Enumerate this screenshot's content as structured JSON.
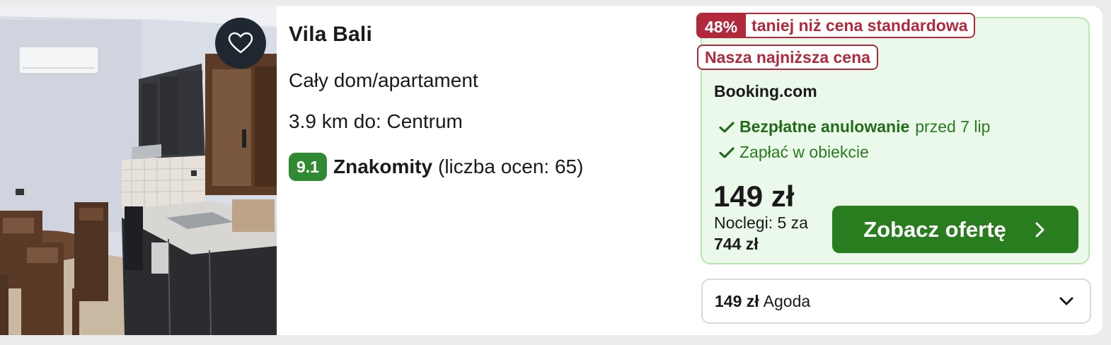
{
  "listing": {
    "title": "Vila Bali",
    "type": "Cały dom/apartament",
    "distance": "3.9 km do: Centrum",
    "rating": {
      "score": "9.1",
      "label": "Znakomity",
      "reviews": "(liczba ocen: 65)"
    },
    "favorite_icon": "heart-outline-icon"
  },
  "deal": {
    "discount_pct": "48%",
    "discount_text": "taniej niż cena standardowa",
    "lowest_badge": "Nasza najniższa cena",
    "provider": "Booking.com",
    "perks": [
      {
        "bold": "Bezpłatne anulowanie",
        "rest": "przed 7 lip",
        "icon": "check-icon"
      },
      {
        "bold": "",
        "rest": "Zapłać w obiekcie",
        "icon": "check-icon"
      }
    ],
    "price": "149 zł",
    "nights_text": "Noclegi: 5 za",
    "total": "744 zł",
    "cta_label": "Zobacz ofertę",
    "cta_icon": "chevron-right-icon"
  },
  "alt_offer": {
    "price": "149 zł",
    "provider": "Agoda",
    "icon": "chevron-down-icon"
  },
  "colors": {
    "rating_green": "#2f8a33",
    "cta_green": "#2a7d1f",
    "deal_bg": "#ebf9ea",
    "discount_red": "#b02a3c"
  }
}
